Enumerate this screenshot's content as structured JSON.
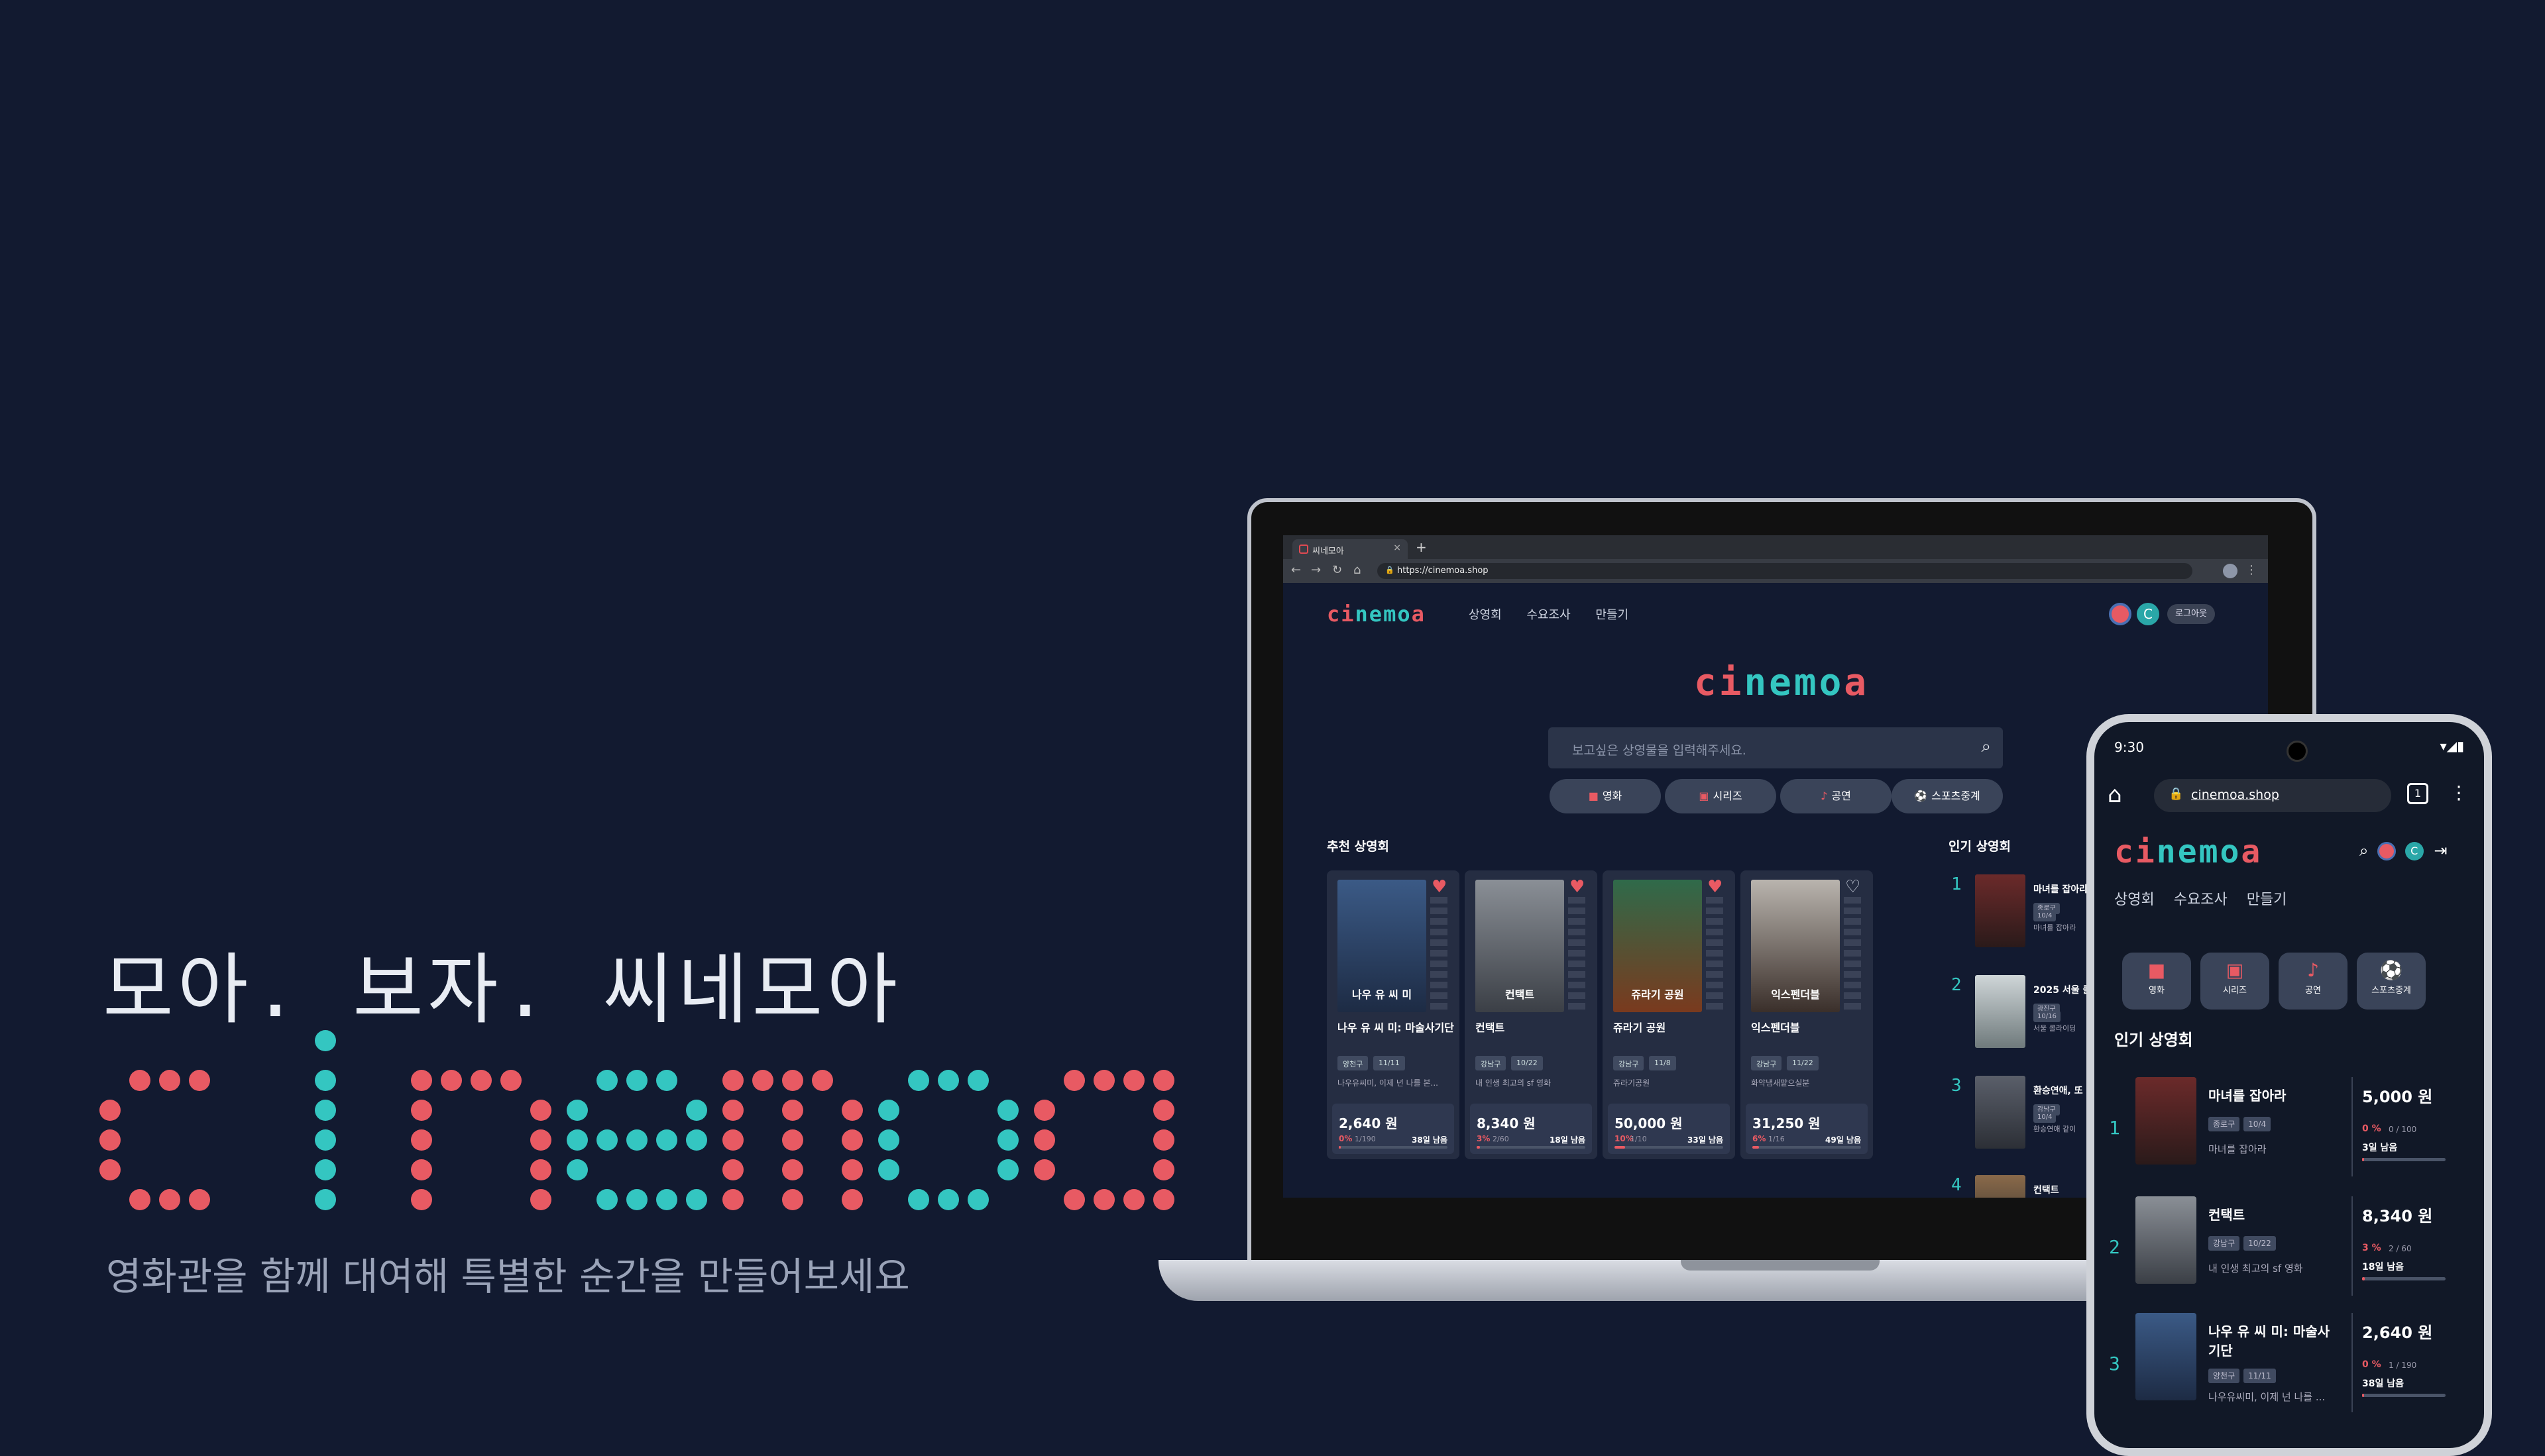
{
  "hero": {
    "tagline": "모아. 보자. 씨네모아",
    "subtitle": "영화관을 함께 대여해 특별한 순간을 만들어보세요",
    "logo_text": "cinemoa"
  },
  "colors": {
    "background": "#121a30",
    "red": "#e85a63",
    "teal": "#34c6c1"
  },
  "browser": {
    "tab_title": "씨네모아",
    "url": "https://cinemoa.shop"
  },
  "site": {
    "logo": "cinemoa",
    "nav": [
      "상영회",
      "수요조사",
      "만들기"
    ],
    "user_initial": "C",
    "logout_label": "로그아웃",
    "search_placeholder": "보고싶은 상영물을 입력해주세요.",
    "categories": [
      {
        "label": "영화",
        "icon": "clapperboard-icon"
      },
      {
        "label": "시리즈",
        "icon": "tv-icon"
      },
      {
        "label": "공연",
        "icon": "microphone-icon"
      },
      {
        "label": "스포츠중계",
        "icon": "soccer-ball-icon"
      }
    ],
    "recommended_title": "추천 상영회",
    "popular_title": "인기 상영회",
    "recommended": [
      {
        "title": "나우 유 씨 미: 마술사기단",
        "poster_text": "나우 유 씨 미",
        "tags": [
          "양천구",
          "11/11"
        ],
        "desc": "나우유씨미, 이제 넌 나를 본...",
        "price": "2,640 원",
        "pct": "0%",
        "count": "1/190",
        "left": "38일 남음",
        "progress": 0.0,
        "liked": true
      },
      {
        "title": "컨택트",
        "poster_text": "컨택트",
        "tags": [
          "강남구",
          "10/22"
        ],
        "desc": "내 인생 최고의 sf 영화",
        "price": "8,340 원",
        "pct": "3%",
        "count": "2/60",
        "left": "18일 남음",
        "progress": 0.03,
        "liked": true
      },
      {
        "title": "쥬라기 공원",
        "poster_text": "쥬라기 공원",
        "tags": [
          "강남구",
          "11/8"
        ],
        "desc": "쥬라기공원",
        "price": "50,000 원",
        "pct": "10%",
        "count": "1/10",
        "left": "33일 남음",
        "progress": 0.1,
        "liked": true
      },
      {
        "title": "익스펜더블",
        "poster_text": "익스펜더블",
        "tags": [
          "강남구",
          "11/22"
        ],
        "desc": "화약냄새맡으실분",
        "price": "31,250 원",
        "pct": "6%",
        "count": "1/16",
        "left": "49일 남음",
        "progress": 0.06,
        "liked": false
      }
    ],
    "popular": [
      {
        "rank": "1",
        "title": "마녀를 잡아라",
        "tags": [
          "종로구",
          "10/4"
        ],
        "desc": "마녀를 잡아라"
      },
      {
        "rank": "2",
        "title": "2025 서울 콜",
        "tags": [
          "광진구",
          "10/16"
        ],
        "desc": "서울 콜라이딩"
      },
      {
        "rank": "3",
        "title": "환승연애, 또 다",
        "tags": [
          "강남구",
          "10/4"
        ],
        "desc": "환승연애 같이"
      },
      {
        "rank": "4",
        "title": "컨택트",
        "tags": [],
        "desc": ""
      }
    ]
  },
  "phone": {
    "time": "9:30",
    "status_icons": "▾◢▮",
    "url": "cinemoa.shop",
    "tab_count": "1",
    "logo": "cinemoa",
    "nav": [
      "상영회",
      "수요조사",
      "만들기"
    ],
    "user_initial": "C",
    "categories": [
      "영화",
      "시리즈",
      "공연",
      "스포츠중계"
    ],
    "section_title": "인기 상영회",
    "items": [
      {
        "rank": "1",
        "title": "마녀를 잡아라",
        "tags": [
          "종로구",
          "10/4"
        ],
        "desc": "마녀를 잡아라",
        "price": "5,000 원",
        "pct": "0 %",
        "count": "0 / 100",
        "left": "3일 남음",
        "progress": 0.0
      },
      {
        "rank": "2",
        "title": "컨택트",
        "tags": [
          "강남구",
          "10/22"
        ],
        "desc": "내 인생 최고의 sf 영화",
        "price": "8,340 원",
        "pct": "3 %",
        "count": "2 / 60",
        "left": "18일 남음",
        "progress": 0.03
      },
      {
        "rank": "3",
        "title": "나우 유 씨 미: 마술사기단",
        "tags": [
          "양천구",
          "11/11"
        ],
        "desc": "나우유씨미, 이제 넌 나를 ...",
        "price": "2,640 원",
        "pct": "0 %",
        "count": "1 / 190",
        "left": "38일 남음",
        "progress": 0.0
      }
    ]
  }
}
